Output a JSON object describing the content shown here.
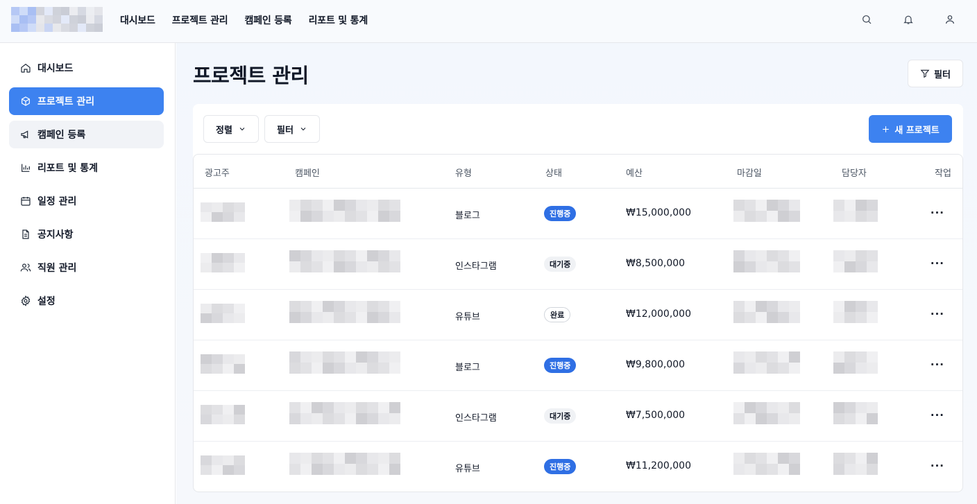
{
  "top_nav": [
    "대시보드",
    "프로젝트 관리",
    "캠페인 등록",
    "리포트 및 통계"
  ],
  "top_icons": [
    "search-icon",
    "bell-icon",
    "user-icon"
  ],
  "sidebar": {
    "items": [
      {
        "label": "대시보드",
        "icon": "home-icon",
        "state": "normal"
      },
      {
        "label": "프로젝트 관리",
        "icon": "box-icon",
        "state": "active"
      },
      {
        "label": "캠페인 등록",
        "icon": "megaphone-icon",
        "state": "hover"
      },
      {
        "label": "리포트 및 통계",
        "icon": "bar-chart-icon",
        "state": "normal"
      },
      {
        "label": "일정 관리",
        "icon": "calendar-icon",
        "state": "normal"
      },
      {
        "label": "공지사항",
        "icon": "document-icon",
        "state": "normal"
      },
      {
        "label": "직원 관리",
        "icon": "users-icon",
        "state": "normal"
      },
      {
        "label": "설정",
        "icon": "gear-icon",
        "state": "normal"
      }
    ]
  },
  "page": {
    "title": "프로젝트 관리",
    "filter_label": "필터"
  },
  "toolbar": {
    "sort_label": "정렬",
    "filter_label": "필터",
    "new_label": "새 프로젝트"
  },
  "table": {
    "columns": [
      "광고주",
      "캠페인",
      "유형",
      "상태",
      "예산",
      "마감일",
      "담당자",
      "작업"
    ],
    "rows": [
      {
        "type": "블로그",
        "status": "진행중",
        "status_kind": "active",
        "budget": "₩15,000,000"
      },
      {
        "type": "인스타그램",
        "status": "대기중",
        "status_kind": "wait",
        "budget": "₩8,500,000"
      },
      {
        "type": "유튜브",
        "status": "완료",
        "status_kind": "done",
        "budget": "₩12,000,000"
      },
      {
        "type": "블로그",
        "status": "진행중",
        "status_kind": "active",
        "budget": "₩9,800,000"
      },
      {
        "type": "인스타그램",
        "status": "대기중",
        "status_kind": "wait",
        "budget": "₩7,500,000"
      },
      {
        "type": "유튜브",
        "status": "진행중",
        "status_kind": "active",
        "budget": "₩11,200,000"
      }
    ],
    "more_glyph": "···"
  },
  "colors": {
    "accent": "#3d82f0",
    "badge_active": "#2f6fe4",
    "badge_wait": "#f0f2f5"
  }
}
